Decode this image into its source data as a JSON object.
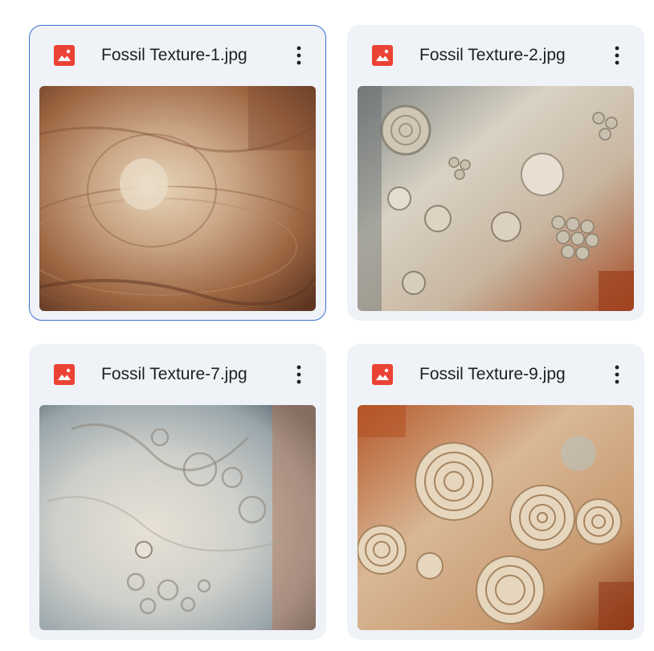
{
  "files": [
    {
      "name": "Fossil Texture-1.jpg",
      "selected": true
    },
    {
      "name": "Fossil Texture-2.jpg",
      "selected": false
    },
    {
      "name": "Fossil Texture-7.jpg",
      "selected": false
    },
    {
      "name": "Fossil Texture-9.jpg",
      "selected": false
    }
  ],
  "icons": {
    "file_type": "image-file-icon",
    "menu": "more-vert-icon"
  },
  "colors": {
    "card_background": "#eff2f7",
    "selected_border": "#3b6fd4",
    "image_icon_red": "#ea4335",
    "text": "#1f1f1f"
  }
}
